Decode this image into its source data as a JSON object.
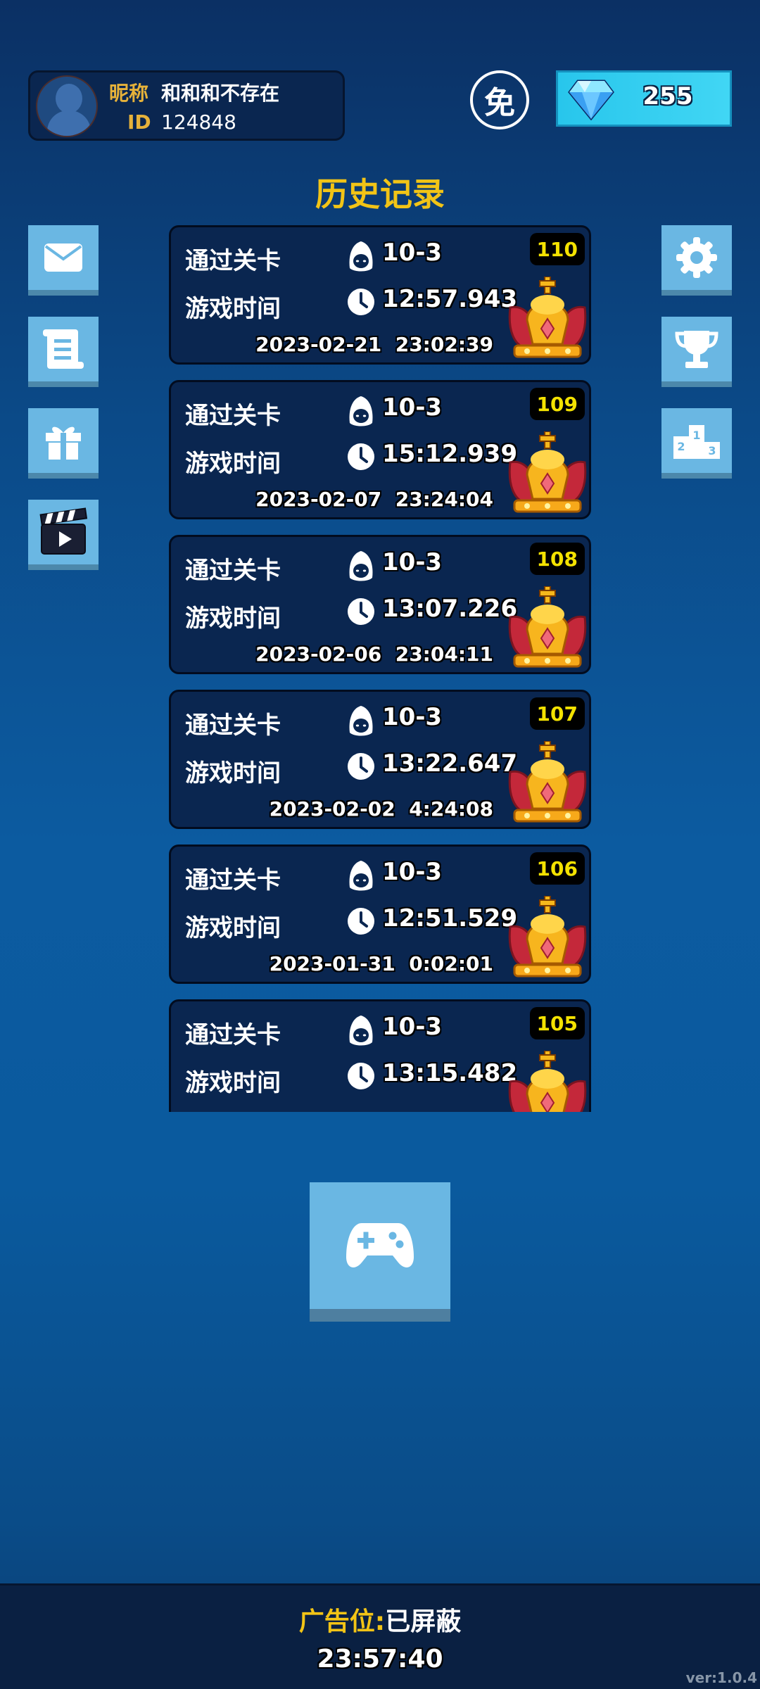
{
  "profile": {
    "nickname_label": "昵称",
    "nickname": "和和和不存在",
    "id_label": "ID",
    "id": "124848"
  },
  "free_badge": "免",
  "currency": {
    "icon": "diamond-icon",
    "amount": "255"
  },
  "title": "历史记录",
  "left_buttons": [
    {
      "icon": "mail-icon"
    },
    {
      "icon": "notes-icon"
    },
    {
      "icon": "gift-icon"
    },
    {
      "icon": "video-clapper-icon"
    }
  ],
  "right_buttons": [
    {
      "icon": "gear-icon"
    },
    {
      "icon": "trophy-icon"
    },
    {
      "icon": "podium-icon"
    }
  ],
  "records": [
    {
      "num": "110",
      "level_label": "通过关卡",
      "level": "10-3",
      "time_label": "游戏时间",
      "time": "12:57.943",
      "date": "2023-02-21  23:02:39"
    },
    {
      "num": "109",
      "level_label": "通过关卡",
      "level": "10-3",
      "time_label": "游戏时间",
      "time": "15:12.939",
      "date": "2023-02-07  23:24:04"
    },
    {
      "num": "108",
      "level_label": "通过关卡",
      "level": "10-3",
      "time_label": "游戏时间",
      "time": "13:07.226",
      "date": "2023-02-06  23:04:11"
    },
    {
      "num": "107",
      "level_label": "通过关卡",
      "level": "10-3",
      "time_label": "游戏时间",
      "time": "13:22.647",
      "date": "2023-02-02  4:24:08"
    },
    {
      "num": "106",
      "level_label": "通过关卡",
      "level": "10-3",
      "time_label": "游戏时间",
      "time": "12:51.529",
      "date": "2023-01-31  0:02:01"
    },
    {
      "num": "105",
      "level_label": "通过关卡",
      "level": "10-3",
      "time_label": "游戏时间",
      "time": "13:15.482",
      "date": ""
    }
  ],
  "play_button": {
    "icon": "gamepad-icon"
  },
  "footer": {
    "ad_label": "广告位:",
    "ad_value": "已屏蔽",
    "clock": "23:57:40",
    "version": "ver:1.0.4"
  }
}
